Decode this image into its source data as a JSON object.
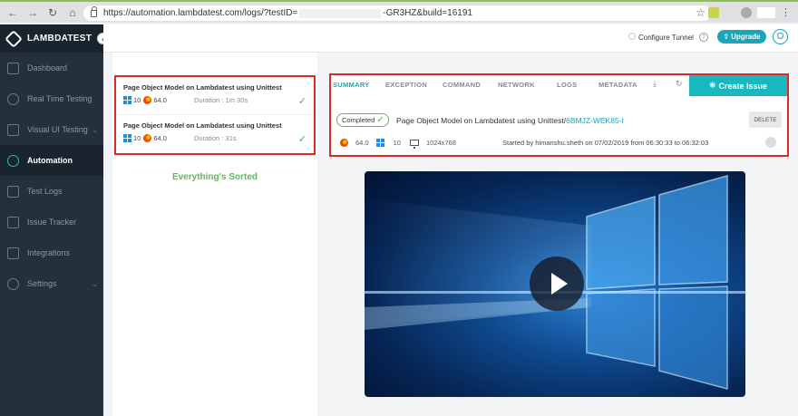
{
  "browser": {
    "url_prefix": "https://automation.lambdatest.com/logs/?testID=",
    "url_suffix": "-GR3HZ&build=16191"
  },
  "sidebar": {
    "brand": "LAMBDATEST",
    "items": [
      {
        "label": "Dashboard",
        "icon": "dashboard-icon"
      },
      {
        "label": "Real Time Testing",
        "icon": "clock-icon"
      },
      {
        "label": "Visual UI Testing",
        "icon": "eye-icon",
        "has_chevron": true
      },
      {
        "label": "Automation",
        "icon": "robot-icon",
        "active": true
      },
      {
        "label": "Test Logs",
        "icon": "cube-icon"
      },
      {
        "label": "Issue Tracker",
        "icon": "bug-icon"
      },
      {
        "label": "Integrations",
        "icon": "plug-icon"
      },
      {
        "label": "Settings",
        "icon": "gear-icon",
        "has_chevron": true
      }
    ]
  },
  "appbar": {
    "tunnel_label": "Configure Tunnel",
    "help": "?",
    "upgrade_label": "Upgrade"
  },
  "test_list": [
    {
      "title": "Page Object Model on Lambdatest using Unittest",
      "os_version": "10",
      "browser_version": "64.0",
      "duration": "Duration : 1m 30s"
    },
    {
      "title": "Page Object Model on Lambdatest using Unittest",
      "os_version": "10",
      "browser_version": "64.0",
      "duration": "Duration : 31s"
    }
  ],
  "empty_message": "Everything's Sorted",
  "detail": {
    "tabs": [
      "SUMMARY",
      "EXCEPTION",
      "COMMAND",
      "NETWORK",
      "LOGS",
      "METADATA"
    ],
    "create_issue_label": "Create Issue",
    "status": "Completed",
    "test_name": "Page Object Model on Lambdatest using Unittest/",
    "test_id": "6BMJZ-WEK85-I",
    "delete_label": "DELETE",
    "browser_version": "64.0",
    "os_version": "10",
    "resolution": "1024x768",
    "started_text": "Started by himanshu.sheth on 07/02/2019 from 06:30:33 to 06:32:03"
  },
  "colors": {
    "accent": "#18a6b8",
    "sidebar_bg": "#24313d",
    "highlight_border": "#d92b2b",
    "success": "#5cb85c"
  }
}
